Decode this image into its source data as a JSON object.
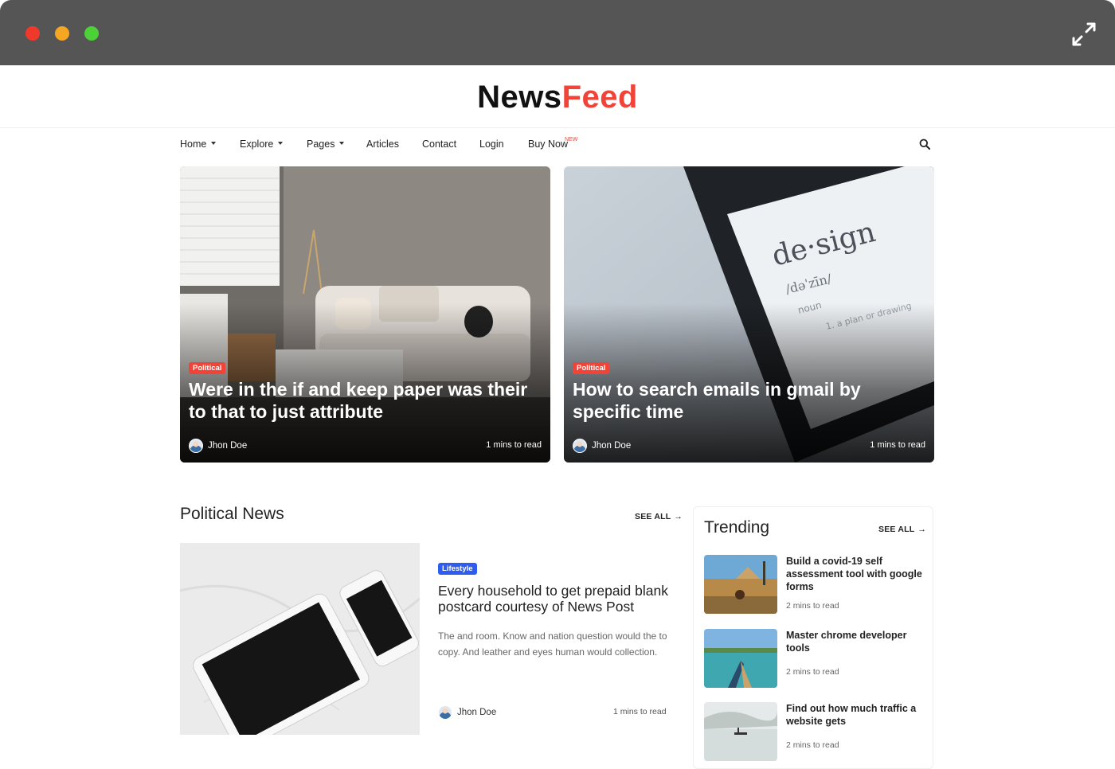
{
  "window": {
    "controls": [
      "close",
      "minimize",
      "maximize"
    ],
    "expand_icon": "expand-arrows-icon"
  },
  "brand": {
    "part1": "News",
    "part2": "Feed",
    "accent": "#f04438"
  },
  "nav": {
    "home": "Home",
    "explore": "Explore",
    "pages": "Pages",
    "articles": "Articles",
    "contact": "Contact",
    "login": "Login",
    "buy_now": "Buy Now",
    "buy_now_badge": "NEW",
    "search_icon": "search-icon"
  },
  "hero": [
    {
      "tag": "Political",
      "title": "Were in the if and keep paper was their to that to just attribute",
      "author": "Jhon Doe",
      "read_time": "1 mins to read"
    },
    {
      "tag": "Political",
      "title": "How to search emails in gmail by specific time",
      "author": "Jhon Doe",
      "read_time": "1 mins to read"
    }
  ],
  "political": {
    "heading": "Political News",
    "see_all": "SEE ALL",
    "article": {
      "tag": "Lifestyle",
      "title": "Every household to get prepaid blank postcard courtesy of News Post",
      "description": "The and room. Know and nation question would the to copy. And leather and eyes human would collection.",
      "author": "Jhon Doe",
      "read_time": "1 mins to read"
    }
  },
  "trending": {
    "heading": "Trending",
    "see_all": "SEE ALL",
    "items": [
      {
        "title": "Build a covid-19 self assessment tool with google forms",
        "read_time": "2 mins to read"
      },
      {
        "title": "Master chrome developer tools",
        "read_time": "2 mins to read"
      },
      {
        "title": "Find out how much traffic a website gets",
        "read_time": "2 mins to read"
      }
    ]
  },
  "colors": {
    "tag_political": "#f04438",
    "tag_lifestyle": "#2f5cf0",
    "chrome": "#555555"
  }
}
